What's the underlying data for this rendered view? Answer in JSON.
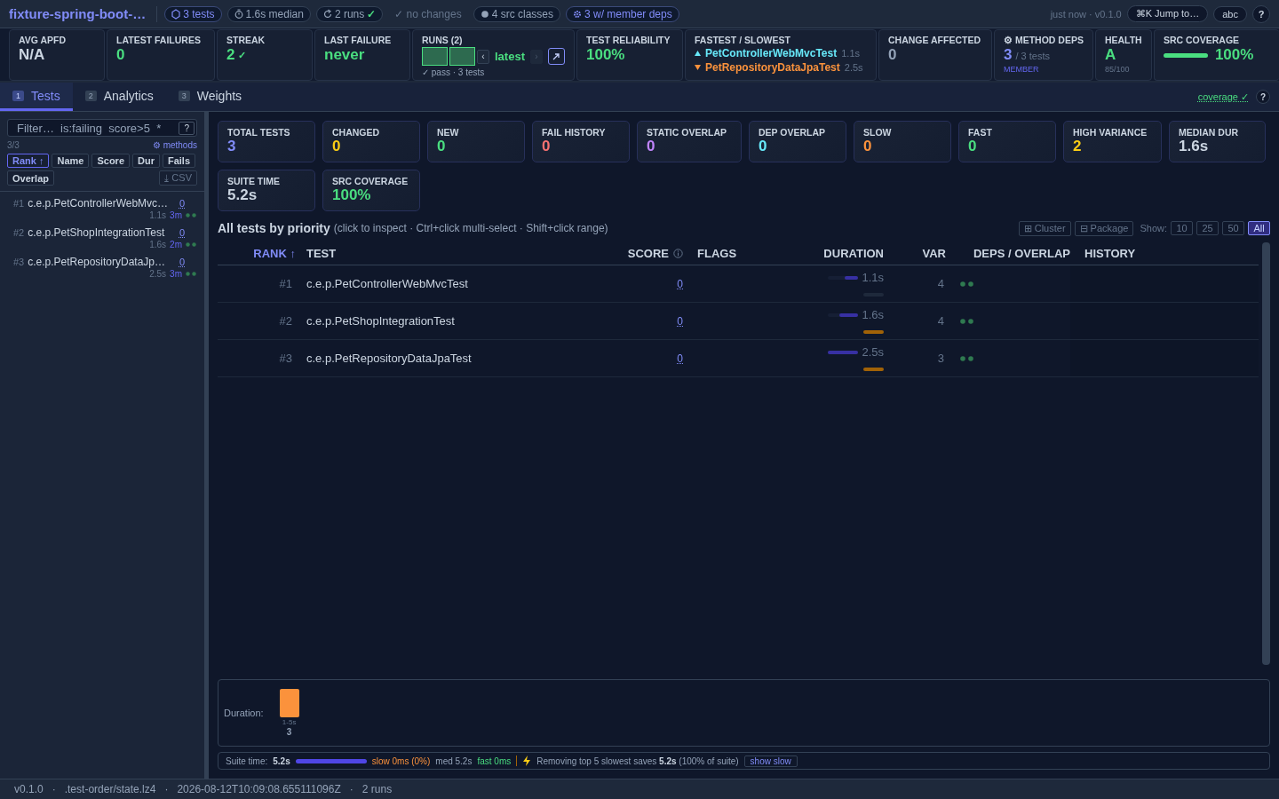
{
  "header": {
    "title": "fixture-spring-boot-…",
    "chips": [
      {
        "kind": "accent",
        "text": "3 tests"
      },
      {
        "kind": "chip",
        "text": "1.6s median"
      },
      {
        "kind": "chip",
        "text": "2 runs",
        "check": "✓"
      },
      {
        "kind": "plain",
        "text": "✓ no changes"
      },
      {
        "kind": "chip",
        "text": "4 src classes"
      },
      {
        "kind": "accent",
        "text": "3 w/ member deps"
      }
    ],
    "meta": "just now · v0.1.0",
    "jump": "⌘K Jump to…",
    "abc": "abc",
    "help": "?"
  },
  "summary": [
    {
      "kind": "stat",
      "label": "AVG APFD",
      "value": "N/A",
      "color": "#cbd5e1"
    },
    {
      "kind": "stat",
      "label": "LATEST FAILURES",
      "value": "0",
      "color": "#4ade80"
    },
    {
      "kind": "stat",
      "label": "STREAK",
      "value": "2",
      "suffix": "✓",
      "color": "#4ade80"
    },
    {
      "kind": "stat",
      "label": "LAST FAILURE",
      "value": "never",
      "color": "#4ade80"
    },
    {
      "kind": "runs",
      "label": "RUNS (2)",
      "runs": [
        {
          "passed": true
        },
        {
          "passed": true
        }
      ],
      "prev": "‹",
      "current": "latest",
      "next": "›",
      "caption": "✓ pass · 3 tests"
    },
    {
      "kind": "stat",
      "label": "TEST RELIABILITY",
      "value": "100%",
      "color": "#4ade80"
    },
    {
      "kind": "extremes",
      "label": "FASTEST / SLOWEST",
      "items": [
        {
          "kind": "fastest",
          "name": "PetControllerWebMvcTest",
          "time": "1.1s"
        },
        {
          "kind": "slowest",
          "name": "PetRepositoryDataJpaTest",
          "time": "2.5s"
        }
      ]
    },
    {
      "kind": "stat",
      "label": "CHANGE AFFECTED",
      "value": "0",
      "color": "#94a3b8"
    },
    {
      "kind": "deps",
      "label": "⚙ METHOD DEPS",
      "value": "3",
      "detail": "/ 3 tests",
      "sub": "MEMBER"
    },
    {
      "kind": "grade",
      "label": "HEALTH",
      "value": "A",
      "sub": "85/100"
    },
    {
      "kind": "coverage",
      "label": "SRC COVERAGE",
      "level": 1.0,
      "value": "100%"
    }
  ],
  "tabs": [
    {
      "num": "1",
      "label": "Tests",
      "selected": true
    },
    {
      "num": "2",
      "label": "Analytics",
      "selected": false
    },
    {
      "num": "3",
      "label": "Weights",
      "selected": false
    }
  ],
  "coverage_link": "coverage ✓",
  "tabs_help": "?",
  "sidebar": {
    "filter_placeholder": "Filter…  is:failing  score>5  *",
    "filter_help": "?",
    "count": "3/3",
    "methods": "⚙ methods",
    "sorts": [
      {
        "label": "Rank ↑",
        "selected": true
      },
      {
        "label": "Name",
        "selected": false
      },
      {
        "label": "Score",
        "selected": false
      },
      {
        "label": "Dur",
        "selected": false
      },
      {
        "label": "Fails",
        "selected": false
      },
      {
        "label": "Overlap",
        "selected": false
      }
    ],
    "csv": "⤓ CSV",
    "items": [
      {
        "rank": "#1",
        "name": "c.e.p.PetControllerWebMvc…",
        "score": "0",
        "duration": "1.1s",
        "age": "3m"
      },
      {
        "rank": "#2",
        "name": "c.e.p.PetShopIntegrationTest",
        "score": "0",
        "duration": "1.6s",
        "age": "2m"
      },
      {
        "rank": "#3",
        "name": "c.e.p.PetRepositoryDataJp…",
        "score": "0",
        "duration": "2.5s",
        "age": "3m"
      }
    ]
  },
  "cards": [
    {
      "label": "TOTAL TESTS",
      "value": "3",
      "color": "#818cf8"
    },
    {
      "label": "CHANGED",
      "value": "0",
      "color": "#facc15"
    },
    {
      "label": "NEW",
      "value": "0",
      "color": "#4ade80"
    },
    {
      "label": "FAIL HISTORY",
      "value": "0",
      "color": "#f87171"
    },
    {
      "label": "STATIC OVERLAP",
      "value": "0",
      "color": "#c084fc"
    },
    {
      "label": "DEP OVERLAP",
      "value": "0",
      "color": "#67e8f9"
    },
    {
      "label": "SLOW",
      "value": "0",
      "color": "#fb923c"
    },
    {
      "label": "FAST",
      "value": "0",
      "color": "#4ade80"
    },
    {
      "label": "HIGH VARIANCE",
      "value": "2",
      "color": "#facc15"
    },
    {
      "label": "MEDIAN DUR",
      "value": "1.6s",
      "color": "#cbd5e1"
    },
    {
      "label": "SUITE TIME",
      "value": "5.2s",
      "color": "#cbd5e1"
    },
    {
      "label": "SRC COVERAGE",
      "value": "100%",
      "color": "#4ade80"
    }
  ],
  "table": {
    "title": "All tests by priority",
    "hint": "(click to inspect · Ctrl+click multi-select · Shift+click range)",
    "views": [
      "⊞ Cluster",
      "⊟ Package"
    ],
    "show_label": "Show:",
    "show": [
      {
        "label": "10",
        "selected": false
      },
      {
        "label": "25",
        "selected": false
      },
      {
        "label": "50",
        "selected": false
      },
      {
        "label": "All",
        "selected": true
      }
    ],
    "columns": [
      {
        "label": "RANK ↑",
        "sorted": true
      },
      {
        "label": "TEST",
        "sorted": false
      },
      {
        "label": "SCORE",
        "sorted": false,
        "info": true
      },
      {
        "label": "FLAGS",
        "sorted": false
      },
      {
        "label": "DURATION",
        "sorted": false
      },
      {
        "label": "VAR",
        "sorted": false
      },
      {
        "label": "DEPS / OVERLAP",
        "sorted": false
      },
      {
        "label": "HISTORY",
        "sorted": false
      }
    ],
    "rows": [
      {
        "rank": "#1",
        "test": "c.e.p.PetControllerWebMvcTest",
        "score": "0",
        "level": 0.44,
        "duration": "1.1s",
        "variance_high": false,
        "var": "4"
      },
      {
        "rank": "#2",
        "test": "c.e.p.PetShopIntegrationTest",
        "score": "0",
        "level": 0.64,
        "duration": "1.6s",
        "variance_high": true,
        "var": "4"
      },
      {
        "rank": "#3",
        "test": "c.e.p.PetRepositoryDataJpaTest",
        "score": "0",
        "level": 1.0,
        "duration": "2.5s",
        "variance_high": true,
        "var": "3"
      }
    ]
  },
  "histogram": {
    "chart_data": {
      "type": "bar",
      "title": "Duration:",
      "categories": [
        "1-5s"
      ],
      "values": [
        3
      ],
      "data_labels": true
    }
  },
  "suite_strip": {
    "label": "Suite time:",
    "total": "5.2s",
    "slow": "slow 0ms (0%)",
    "med": "med 5.2s",
    "fast": "fast 0ms",
    "tip_pre": "Removing top 5 slowest saves",
    "tip_bold": "5.2s",
    "tip_post": "(100% of suite)",
    "button": "show slow"
  },
  "status_bar": [
    "v0.1.0",
    "·",
    ".test-order/state.lz4",
    "·",
    "2026-08-12T10:09:08.655111096Z",
    "·",
    "2 runs"
  ]
}
